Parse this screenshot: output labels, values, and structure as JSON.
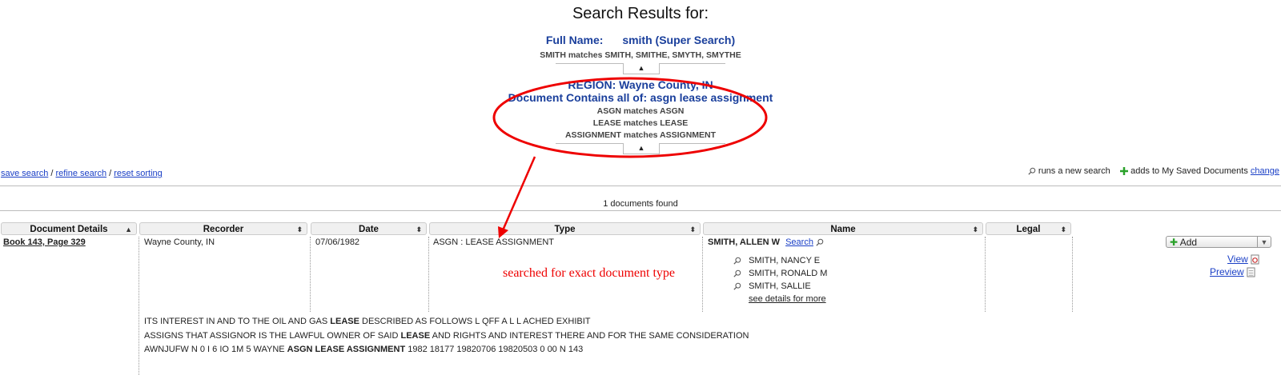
{
  "header": {
    "title": "Search Results for:",
    "full_name_label": "Full Name:",
    "full_name_value": "smith (Super Search)",
    "name_matches": "SMITH  matches  SMITH, SMITHE, SMYTH, SMYTHE",
    "region": "REGION: Wayne County, IN",
    "contains": "Document Contains all of: asgn lease assignment",
    "term_matches": [
      "ASGN matches ASGN",
      "LEASE matches LEASE",
      "ASSIGNMENT matches ASSIGNMENT"
    ]
  },
  "toolbar": {
    "save_search": "save search",
    "sep1": " / ",
    "refine_search": "refine search",
    "sep2": " / ",
    "reset_sorting": "reset sorting",
    "runs_new_search": "runs a new search",
    "adds_to_saved": "adds to My Saved Documents",
    "change": "change"
  },
  "results": {
    "count_text": "1 documents found",
    "columns": [
      "Document Details",
      "Recorder",
      "Date",
      "Type",
      "Name",
      "Legal"
    ],
    "row": {
      "document": "Book 143, Page 329",
      "recorder": "Wayne County, IN",
      "date": "07/06/1982",
      "type": "ASGN : LEASE ASSIGNMENT",
      "primary_name": "SMITH, ALLEN W",
      "search_link": "Search",
      "other_names": [
        "SMITH, NANCY E",
        "SMITH, RONALD M",
        "SMITH, SALLIE"
      ],
      "see_details": "see details for more",
      "add_label": "Add",
      "view_label": "View",
      "preview_label": "Preview"
    },
    "excerpt": [
      {
        "pre": "ITS INTEREST IN AND TO THE OIL AND GAS ",
        "b": "LEASE",
        "post": " DESCRIBED AS FOLLOWS L QFF A L L ACHED EXHIBIT"
      },
      {
        "pre": "ASSIGNS THAT ASSIGNOR IS THE LAWFUL OWNER OF SAID ",
        "b": "LEASE",
        "post": " AND RIGHTS AND INTEREST THERE AND FOR THE SAME CONSIDERATION"
      },
      {
        "pre": "AWNJUFW N 0 I 6 IO 1M 5 WAYNE ",
        "b": "ASGN LEASE ASSIGNMENT",
        "post": " 1982 18177 19820706 19820503 0 00 N 143"
      }
    ]
  },
  "annotation": {
    "text": "searched for exact document type",
    "color": "#e00000"
  }
}
